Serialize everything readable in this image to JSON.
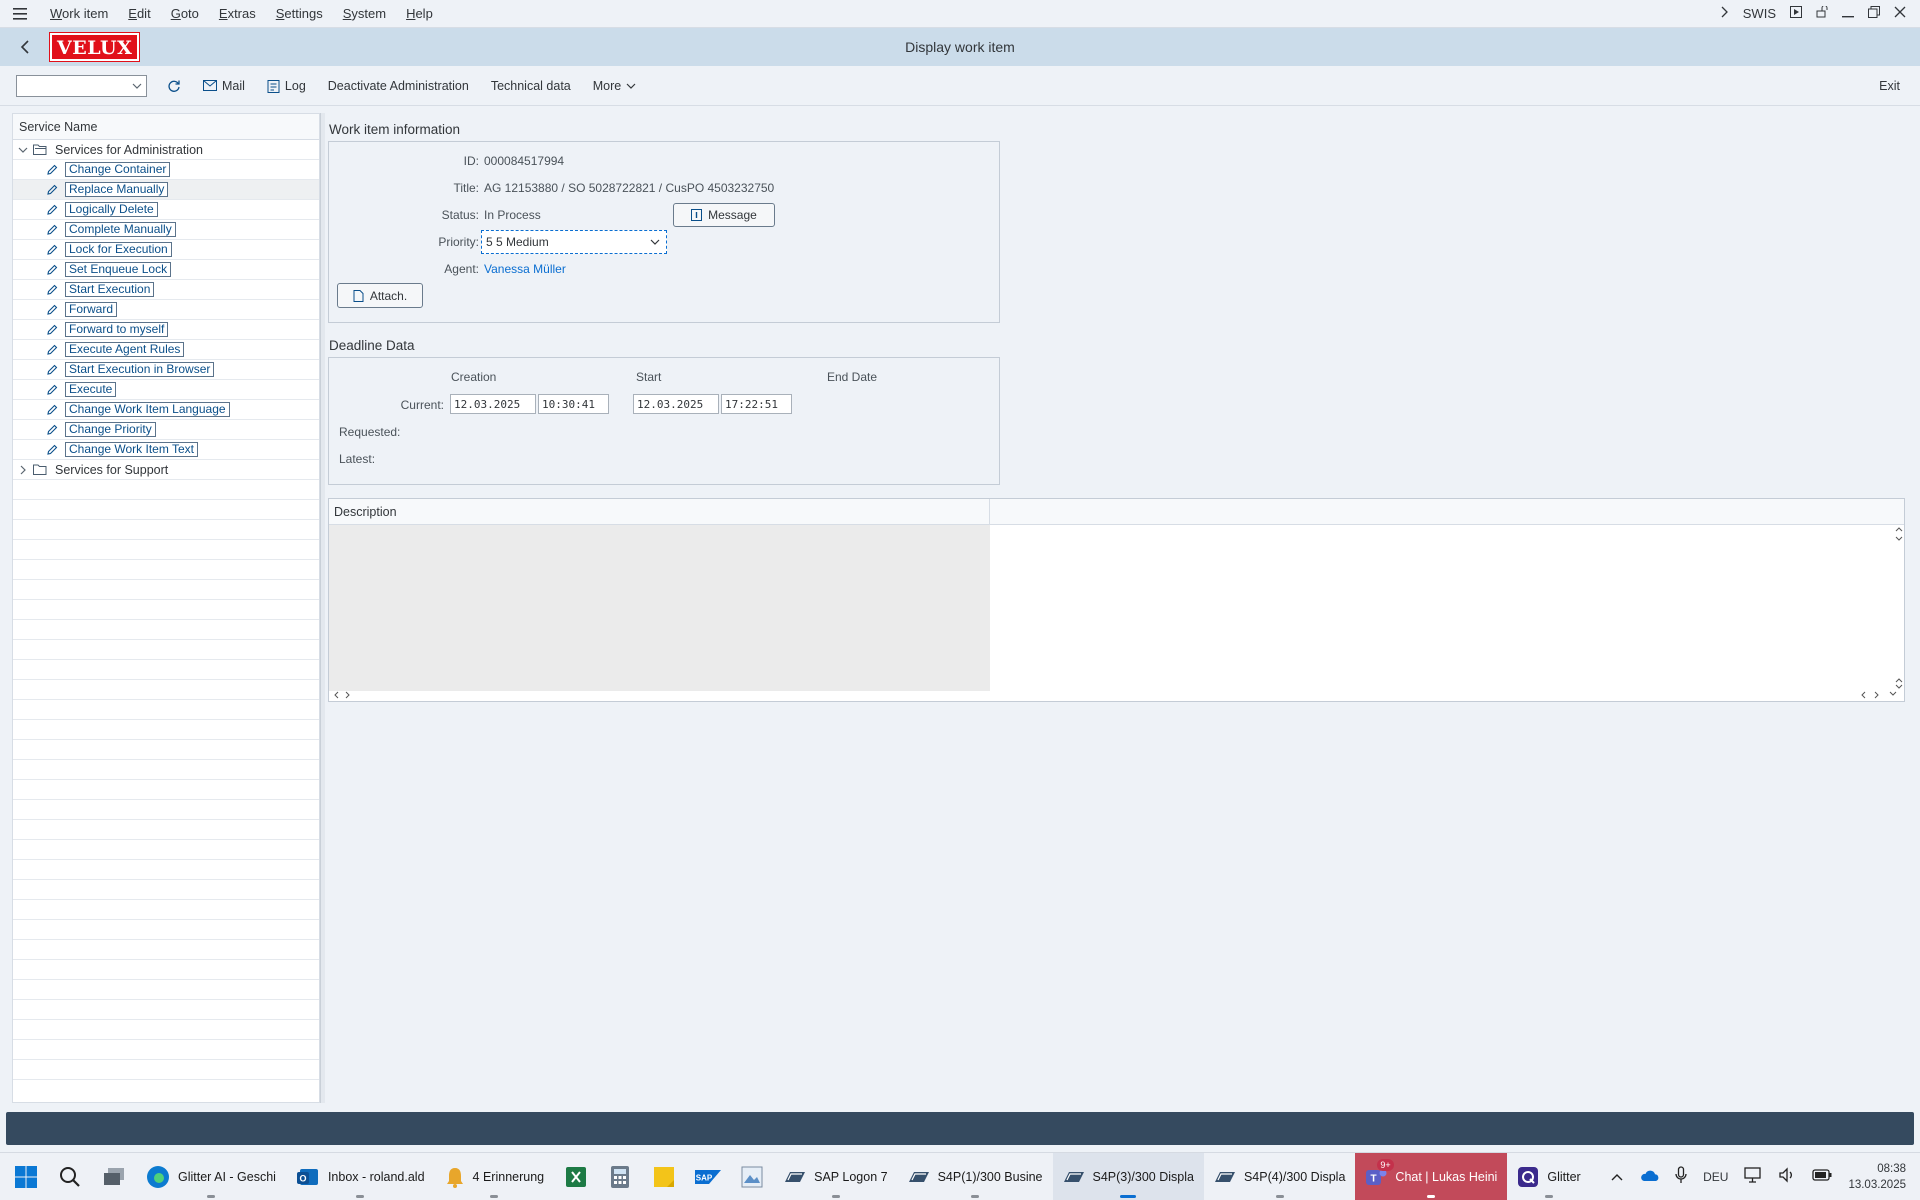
{
  "menubar": {
    "items": [
      "Work item",
      "Edit",
      "Goto",
      "Extras",
      "Settings",
      "System",
      "Help"
    ],
    "system_id": "SWIS"
  },
  "titlebar": {
    "logo": "VELUX",
    "title": "Display work item"
  },
  "toolbar": {
    "mail": "Mail",
    "log": "Log",
    "deactivate": "Deactivate Administration",
    "technical": "Technical data",
    "more": "More",
    "exit": "Exit"
  },
  "tree": {
    "header": "Service Name",
    "admin_folder": "Services for Administration",
    "admin_items": [
      "Change Container",
      "Replace Manually",
      "Logically Delete",
      "Complete Manually",
      "Lock for Execution",
      "Set Enqueue Lock",
      "Start Execution",
      "Forward",
      "Forward to myself",
      "Execute Agent Rules",
      "Start Execution in Browser",
      "Execute",
      "Change Work Item Language",
      "Change Priority",
      "Change Work Item Text"
    ],
    "support_folder": "Services for Support"
  },
  "workitem": {
    "section": "Work item information",
    "id_label": "ID:",
    "id": "000084517994",
    "title_label": "Title:",
    "title": "AG 12153880 / SO 5028722821 / CusPO 4503232750",
    "status_label": "Status:",
    "status": "In Process",
    "message_btn": "Message",
    "priority_label": "Priority:",
    "priority": "5 5 Medium",
    "agent_label": "Agent:",
    "agent": "Vanessa Müller",
    "attach_btn": "Attach."
  },
  "deadline": {
    "section": "Deadline Data",
    "col_creation": "Creation",
    "col_start": "Start",
    "col_end": "End Date",
    "current_label": "Current:",
    "creation_date": "12.03.2025",
    "creation_time": "10:30:41",
    "start_date": "12.03.2025",
    "start_time": "17:22:51",
    "requested_label": "Requested:",
    "latest_label": "Latest:"
  },
  "description": {
    "header": "Description"
  },
  "taskbar": {
    "apps": [
      {
        "label": "Glitter AI - Geschi"
      },
      {
        "label": "Inbox - roland.ald"
      },
      {
        "label": "4 Erinnerung"
      },
      {
        "label": "SAP Logon 7"
      },
      {
        "label": "S4P(1)/300 Busine"
      },
      {
        "label": "S4P(3)/300 Displa"
      },
      {
        "label": "S4P(4)/300 Displa"
      },
      {
        "label": "Chat | Lukas Heini"
      },
      {
        "label": "Glitter"
      }
    ],
    "teams_badge": "9+",
    "lang": "DEU",
    "time": "08:38",
    "date": "13.03.2025"
  },
  "colors": {
    "velux_red": "#e1101a",
    "status_bar": "#354a5f",
    "link": "#0a6ed1"
  }
}
